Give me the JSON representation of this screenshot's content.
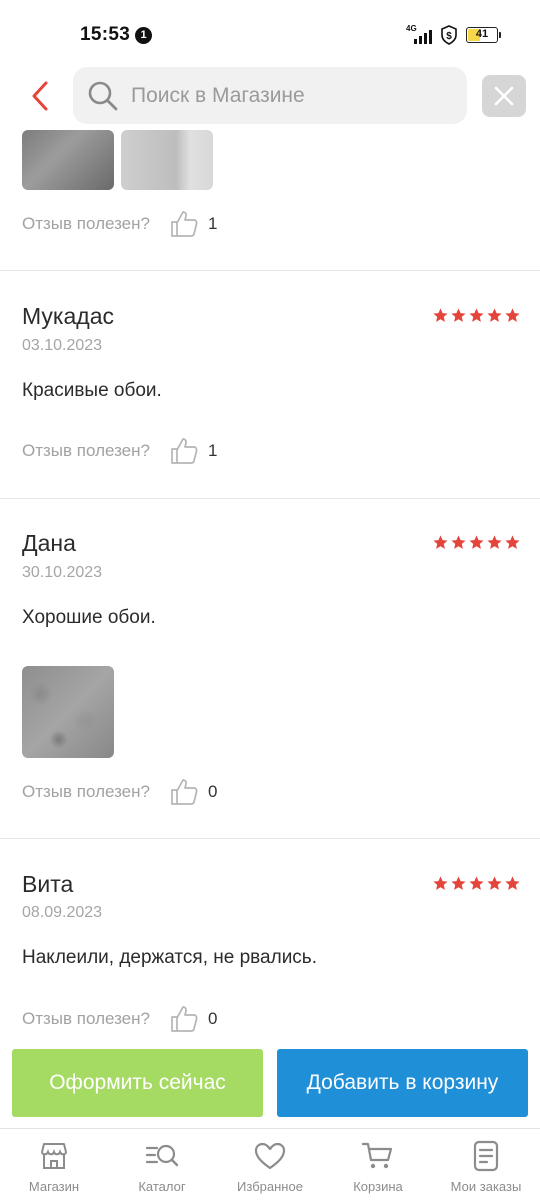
{
  "status_bar": {
    "time": "15:53",
    "notification_count": "1",
    "network": "4G",
    "battery": "41"
  },
  "header": {
    "search_placeholder": "Поиск в Магазине"
  },
  "helpful_label": "Отзыв полезен?",
  "top_partial_review": {
    "helpful_count": "1"
  },
  "reviews": [
    {
      "name": "Мукадас",
      "date": "03.10.2023",
      "text": "Красивые обои.",
      "rating": 5,
      "helpful_count": "1"
    },
    {
      "name": "Дана",
      "date": "30.10.2023",
      "text": "Хорошие обои.",
      "rating": 5,
      "helpful_count": "0"
    },
    {
      "name": "Вита",
      "date": "08.09.2023",
      "text": "Наклеили, держатся, не рвались.",
      "rating": 5,
      "helpful_count": "0"
    }
  ],
  "actions": {
    "buy_now": "Оформить сейчас",
    "add_to_cart": "Добавить в корзину"
  },
  "bottom_nav": [
    {
      "label": "Магазин",
      "icon": "store-icon"
    },
    {
      "label": "Каталог",
      "icon": "catalog-search-icon"
    },
    {
      "label": "Избранное",
      "icon": "heart-icon"
    },
    {
      "label": "Корзина",
      "icon": "cart-icon"
    },
    {
      "label": "Мои заказы",
      "icon": "orders-icon"
    }
  ],
  "colors": {
    "accent_red": "#e5443b",
    "star_red": "#e5443b",
    "buy_green": "#a5da63",
    "cart_blue": "#1f8fd8"
  }
}
